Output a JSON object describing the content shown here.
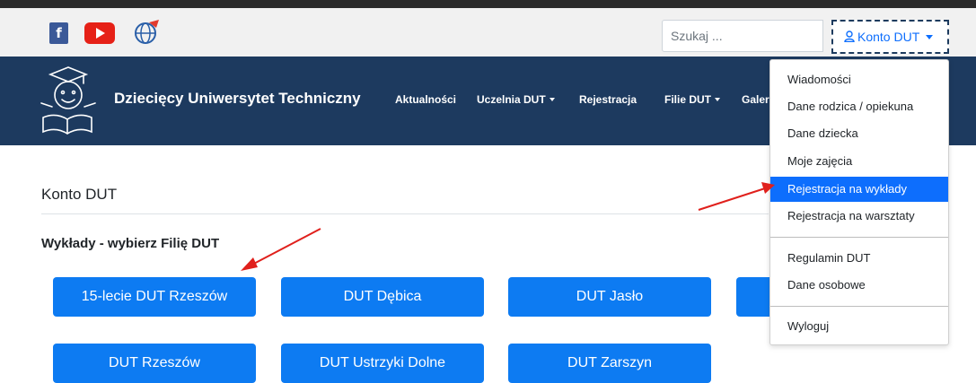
{
  "topbar": {
    "social": [
      "facebook-icon",
      "youtube-icon",
      "globe-logo-icon"
    ],
    "facebook_glyph": "f",
    "search_placeholder": "Szukaj ...",
    "account_label": "Konto DUT"
  },
  "navbar": {
    "brand": "Dziecięcy Uniwersytet Techniczny",
    "items": [
      {
        "label": "Aktualności"
      },
      {
        "label": "Uczelnia DUT"
      },
      {
        "label": "Rejestracja"
      },
      {
        "label": "Filie DUT"
      },
      {
        "label": "Galeria"
      }
    ]
  },
  "content": {
    "title": "Konto DUT",
    "section_title": "Wykłady - wybierz Filię DUT",
    "branches": [
      "15-lecie DUT Rzeszów",
      "DUT Dębica",
      "DUT Jasło",
      "DUT Rzeszów",
      "DUT Ustrzyki Dolne",
      "DUT Zarszyn"
    ]
  },
  "dropdown": {
    "groups": [
      [
        "Wiadomości",
        "Dane rodzica / opiekuna",
        "Dane dziecka",
        "Moje zajęcia",
        "Rejestracja na wykłady",
        "Rejestracja na warsztaty"
      ],
      [
        "Regulamin DUT",
        "Dane osobowe"
      ],
      [
        "Wyloguj"
      ]
    ],
    "active": "Rejestracja na wykłady"
  },
  "colors": {
    "navbar": "#1d3a5f",
    "primary_button": "#0d7bf2",
    "active_item": "#0d6efd",
    "annotation_arrow": "#e0201c"
  }
}
